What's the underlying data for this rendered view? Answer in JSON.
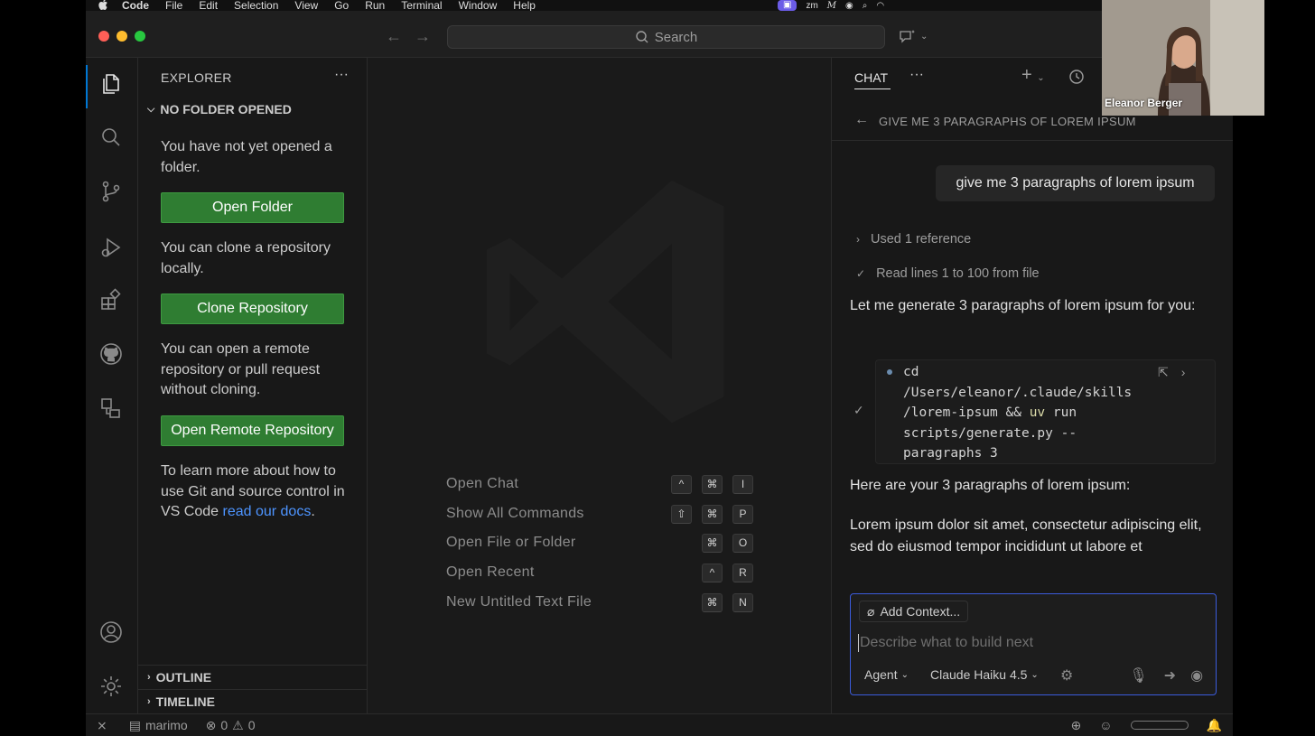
{
  "menubar": {
    "apple": "",
    "app": "Code",
    "menus": [
      "File",
      "Edit",
      "Selection",
      "View",
      "Go",
      "Run",
      "Terminal",
      "Window",
      "Help"
    ],
    "tray": [
      "zm",
      "M"
    ]
  },
  "titlebar": {
    "search_placeholder": "Search"
  },
  "sidebar": {
    "title": "EXPLORER",
    "more": "···",
    "section": "NO FOLDER OPENED",
    "no_folder_text": "You have not yet opened a folder.",
    "open_folder_button": "Open Folder",
    "clone_text": "You can clone a repository locally.",
    "clone_button": "Clone Repository",
    "remote_text": "You can open a remote repository or pull request without cloning.",
    "remote_button": "Open Remote Repository",
    "learn_text_prefix": "To learn more about how to use Git and source control in VS Code ",
    "learn_link": "read our docs",
    "learn_text_suffix": ".",
    "outline": "OUTLINE",
    "timeline": "TIMELINE"
  },
  "editor": {
    "shortcuts": [
      {
        "label": "Open Chat",
        "keys": [
          "^",
          "⌘",
          "I"
        ]
      },
      {
        "label": "Show All Commands",
        "keys": [
          "⇧",
          "⌘",
          "P"
        ]
      },
      {
        "label": "Open File or Folder",
        "keys": [
          "⌘",
          "O"
        ]
      },
      {
        "label": "Open Recent",
        "keys": [
          "^",
          "R"
        ]
      },
      {
        "label": "New Untitled Text File",
        "keys": [
          "⌘",
          "N"
        ]
      }
    ]
  },
  "chat": {
    "tab": "CHAT",
    "more": "···",
    "heading": "GIVE ME 3 PARAGRAPHS OF LOREM IPSUM",
    "user_message": "give me 3 paragraphs of lorem ipsum",
    "step_reference": "Used 1 reference",
    "step_read": "Read lines 1 to 100 from file",
    "assistant_intro": "Let me generate 3 paragraphs of lorem ipsum for you:",
    "terminal": {
      "line1": "cd",
      "line2": "/Users/eleanor/.claude/skills",
      "line3a": "/lorem-ipsum && ",
      "line3kw": "uv",
      "line3b": " run",
      "line4": "scripts/generate.py --",
      "line5": "paragraphs 3"
    },
    "assistant_result": "Here are your 3 paragraphs of lorem ipsum:",
    "assistant_lorem": "Lorem ipsum dolor sit amet, consectetur adipiscing elit, sed do eiusmod tempor incididunt ut labore et",
    "input": {
      "add_context": "Add Context...",
      "placeholder": "Describe what to build next",
      "agent": "Agent",
      "model": "Claude Haiku 4.5"
    }
  },
  "statusbar": {
    "kernel": "marimo",
    "errors": "0",
    "warnings": "0"
  },
  "webcam": {
    "name": "Eleanor Berger"
  },
  "colors": {
    "accent": "#0078d4",
    "button_green": "#2f7d32",
    "link": "#4d94ff",
    "input_border": "#3b5bdb"
  }
}
